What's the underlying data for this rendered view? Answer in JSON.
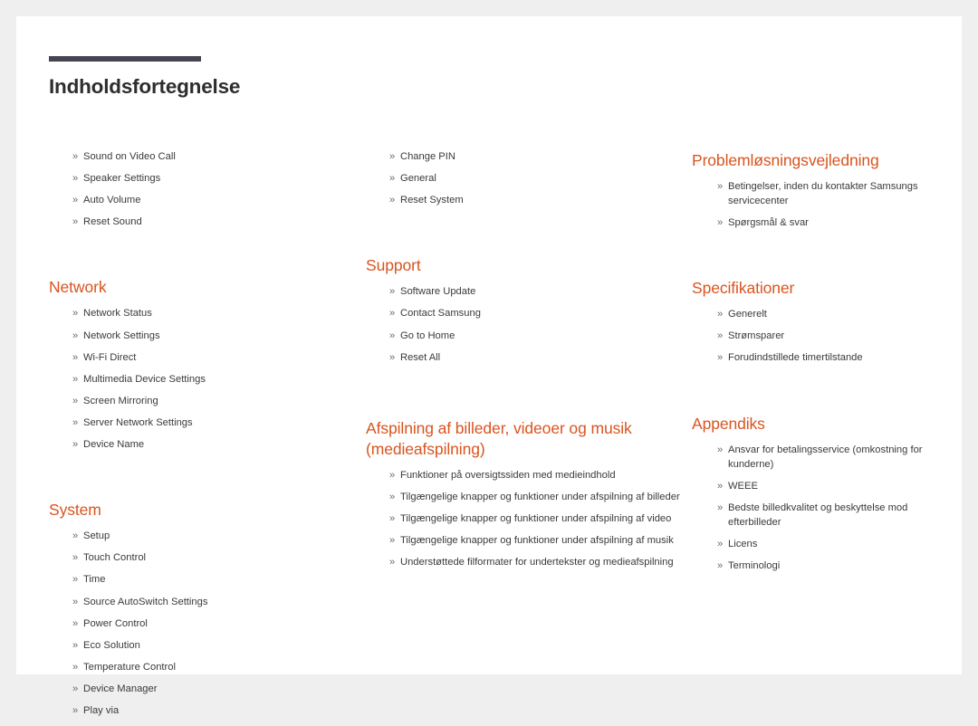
{
  "document": {
    "title": "Indholdsfortegnelse",
    "bullet_glyph": "»",
    "accent_color": "#d9541f",
    "rule_color": "#454551",
    "text_color": "#3a3a3a",
    "title_color": "#2d2d2d",
    "page_background": "#ffffff",
    "canvas_background": "#efefef"
  },
  "columns": [
    {
      "id": "column-1",
      "sections": [
        {
          "id": "continued-sound",
          "heading": "",
          "items": [
            "Sound on Video Call",
            "Speaker Settings",
            "Auto Volume",
            "Reset Sound"
          ]
        },
        {
          "id": "network",
          "heading": "Network",
          "items": [
            "Network Status",
            "Network Settings",
            "Wi-Fi Direct",
            "Multimedia Device Settings",
            "Screen Mirroring",
            "Server Network Settings",
            "Device Name"
          ]
        },
        {
          "id": "system",
          "heading": "System",
          "items": [
            "Setup",
            "Touch Control",
            "Time",
            "Source AutoSwitch Settings",
            "Power Control",
            "Eco Solution",
            "Temperature Control",
            "Device Manager",
            "Play via"
          ]
        }
      ]
    },
    {
      "id": "column-2",
      "sections": [
        {
          "id": "continued-system",
          "heading": "",
          "items": [
            "Change PIN",
            "General",
            "Reset System"
          ]
        },
        {
          "id": "support",
          "heading": "Support",
          "items": [
            "Software Update",
            "Contact Samsung",
            "Go to Home",
            "Reset All"
          ]
        },
        {
          "id": "media-playback",
          "heading": "Afspilning af billeder, videoer og musik (medieafspilning)",
          "items": [
            "Funktioner på oversigtssiden med medieindhold",
            "Tilgængelige knapper og funktioner under afspilning af billeder",
            "Tilgængelige knapper og funktioner under afspilning af video",
            "Tilgængelige knapper og funktioner under afspilning af musik",
            "Understøttede filformater for undertekster og medieafspilning"
          ]
        }
      ]
    },
    {
      "id": "column-3",
      "sections": [
        {
          "id": "troubleshooting",
          "heading": "Problemløsningsvejledning",
          "items": [
            "Betingelser, inden du kontakter Samsungs servicecenter",
            "Spørgsmål & svar"
          ]
        },
        {
          "id": "specifications",
          "heading": "Specifikationer",
          "items": [
            "Generelt",
            "Strømsparer",
            "Forudindstillede timertilstande"
          ]
        },
        {
          "id": "appendix",
          "heading": "Appendiks",
          "items": [
            "Ansvar for betalingsservice (omkostning for kunderne)",
            "WEEE",
            "Bedste billedkvalitet og beskyttelse mod efterbilleder",
            "Licens",
            "Terminologi"
          ]
        }
      ]
    }
  ]
}
